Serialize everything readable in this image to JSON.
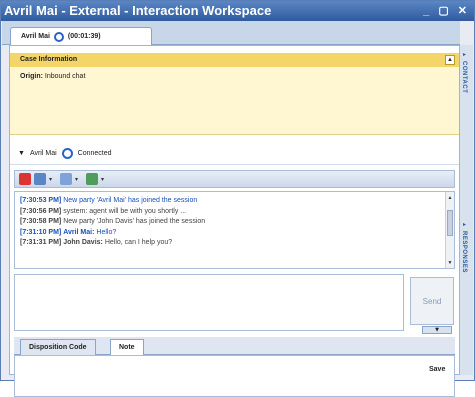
{
  "window": {
    "title": "Avril Mai - External - Interaction Workspace",
    "controls": "_ ▢ ✕"
  },
  "interaction_tab": {
    "party": "Avril Mai",
    "timer": "(00:01:39)"
  },
  "case_info": {
    "header": "Case Information",
    "origin_label": "Origin:",
    "origin_value": "Inbound chat"
  },
  "party_row": {
    "name": "Avril Mai",
    "status": "Connected"
  },
  "transcript": [
    {
      "time": "[7:30:53 PM]",
      "text": "New party 'Avril Mai' has joined the session",
      "color": "blue"
    },
    {
      "time": "[7:30:56 PM]",
      "text": "system: agent will be with you shortly ...",
      "color": "gray"
    },
    {
      "time": "[7:30:58 PM]",
      "text": "New party 'John Davis' has joined the session",
      "color": "gray"
    },
    {
      "time": "[7:31:10 PM]",
      "speaker": "Avril Mai:",
      "text": "Hello?",
      "color": "blue"
    },
    {
      "time": "[7:31:31 PM]",
      "speaker": "John Davis:",
      "text": "Hello, can I help you?",
      "color": "gray"
    }
  ],
  "compose": {
    "send_label": "Send"
  },
  "bottom_tabs": {
    "disposition_label": "Disposition Code",
    "note_label": "Note"
  },
  "save_label": "Save",
  "side_panel": {
    "contact_label": "CONTACT",
    "responses_label": "RESPONSES"
  },
  "colors": {
    "title_bar": "#2f5b9c",
    "case_header": "#f3d56a",
    "case_body": "#fff7d2",
    "accent_blue": "#1a4fb8"
  }
}
